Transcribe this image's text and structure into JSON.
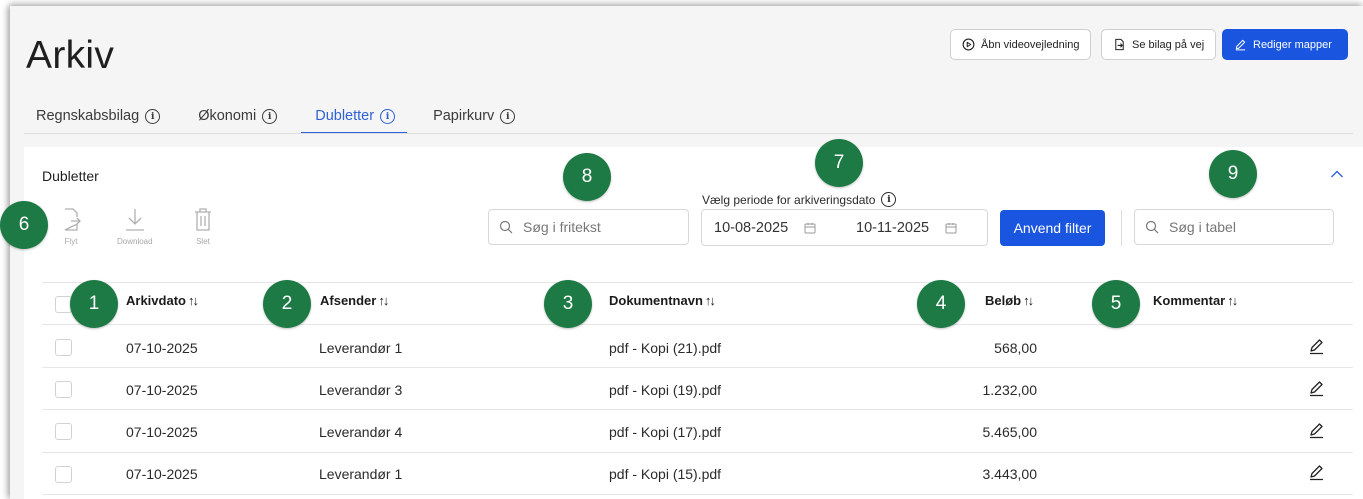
{
  "page": {
    "title": "Arkiv"
  },
  "header_buttons": {
    "video": "Åbn videovejledning",
    "bilag": "Se bilag på vej",
    "edit": "Rediger mapper"
  },
  "tabs": [
    {
      "label": "Regnskabsbilag",
      "active": false
    },
    {
      "label": "Økonomi",
      "active": false
    },
    {
      "label": "Dubletter",
      "active": true
    },
    {
      "label": "Papirkurv",
      "active": false
    }
  ],
  "section": {
    "title": "Dubletter"
  },
  "toolbar": {
    "move": "Flyt",
    "download": "Download",
    "delete": "Slet"
  },
  "filters": {
    "freetext_placeholder": "Søg i fritekst",
    "period_label": "Vælg periode for arkiveringsdato",
    "date_from": "10-08-2025",
    "date_to": "10-11-2025",
    "apply": "Anvend filter",
    "table_search_placeholder": "Søg i tabel"
  },
  "table": {
    "columns": [
      "Arkivdato",
      "Afsender",
      "Dokumentnavn",
      "Beløb",
      "Kommentar"
    ],
    "rows": [
      {
        "date": "07-10-2025",
        "sender": "Leverandør 1",
        "doc": "pdf - Kopi (21).pdf",
        "amount": "568,00",
        "comment": ""
      },
      {
        "date": "07-10-2025",
        "sender": "Leverandør 3",
        "doc": "pdf - Kopi (19).pdf",
        "amount": "1.232,00",
        "comment": ""
      },
      {
        "date": "07-10-2025",
        "sender": "Leverandør 4",
        "doc": "pdf - Kopi (17).pdf",
        "amount": "5.465,00",
        "comment": ""
      },
      {
        "date": "07-10-2025",
        "sender": "Leverandør 1",
        "doc": "pdf - Kopi (15).pdf",
        "amount": "3.443,00",
        "comment": ""
      }
    ]
  },
  "badges": [
    "1",
    "2",
    "3",
    "4",
    "5",
    "6",
    "7",
    "8",
    "9"
  ],
  "colors": {
    "accent": "#1a55e0",
    "tab_active": "#2f62d6",
    "badge": "#1d7a45"
  }
}
